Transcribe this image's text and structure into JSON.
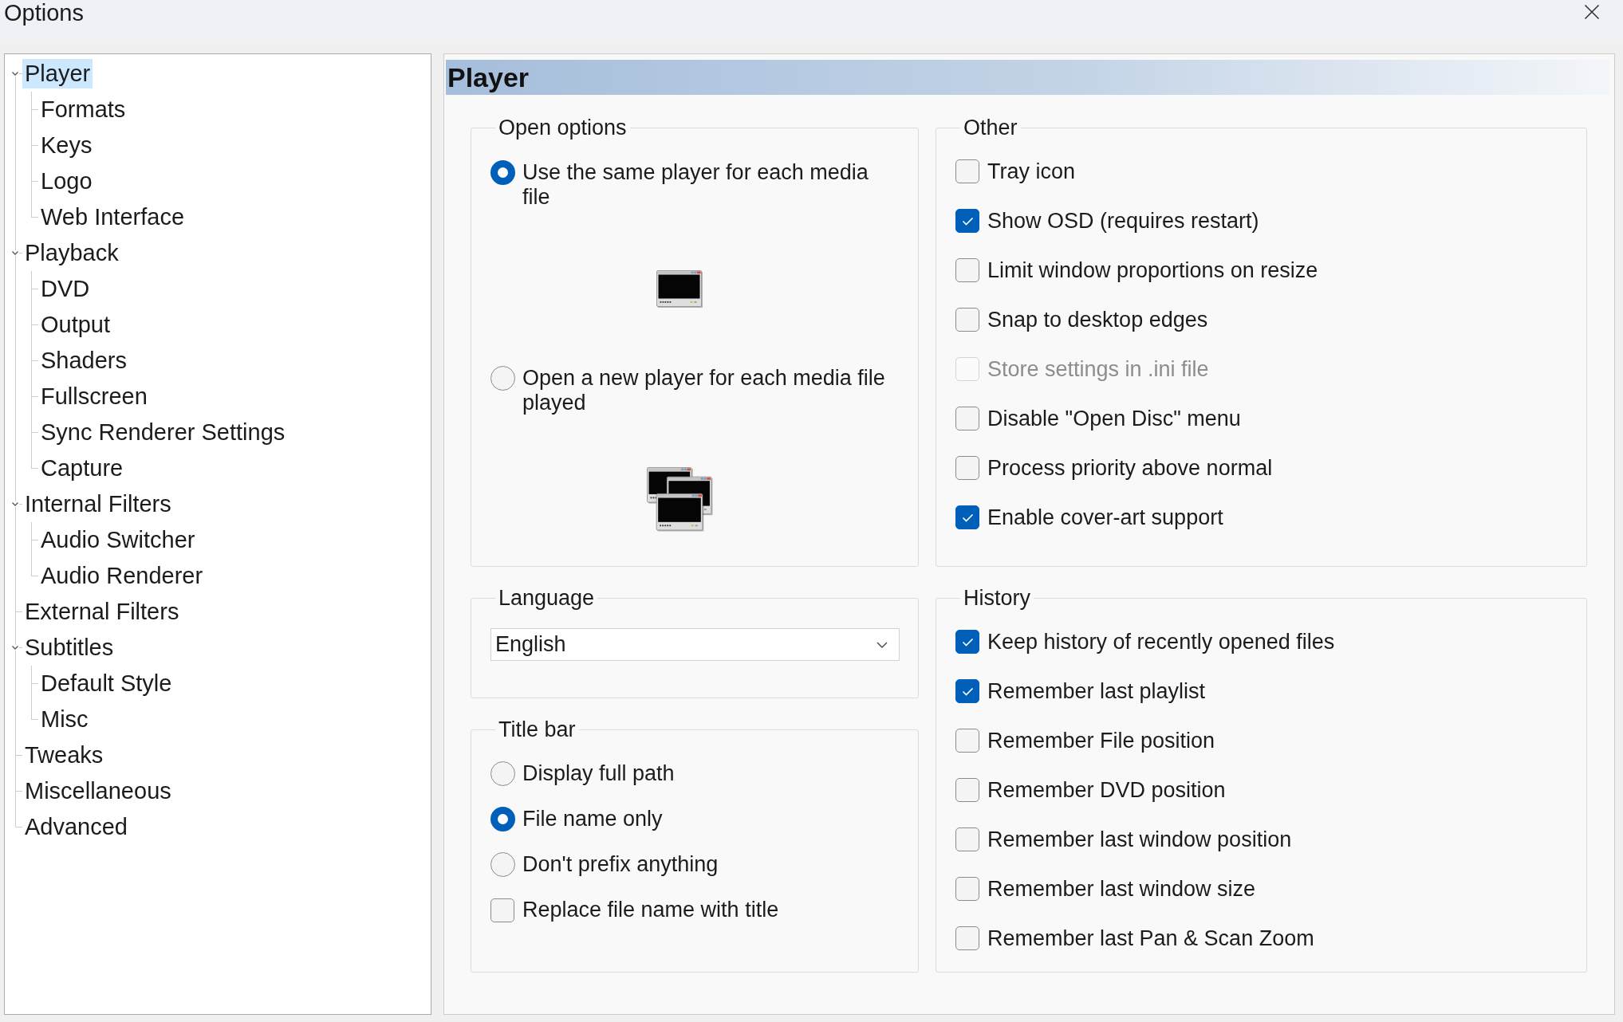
{
  "window": {
    "title": "Options"
  },
  "tree": [
    {
      "label": "Player",
      "selected": true,
      "expanded": true,
      "children": [
        {
          "label": "Formats",
          "selected": false
        },
        {
          "label": "Keys",
          "selected": false
        },
        {
          "label": "Logo",
          "selected": false
        },
        {
          "label": "Web Interface",
          "selected": false
        }
      ]
    },
    {
      "label": "Playback",
      "selected": false,
      "expanded": true,
      "children": [
        {
          "label": "DVD",
          "selected": false
        },
        {
          "label": "Output",
          "selected": false
        },
        {
          "label": "Shaders",
          "selected": false
        },
        {
          "label": "Fullscreen",
          "selected": false
        },
        {
          "label": "Sync Renderer Settings",
          "selected": false
        },
        {
          "label": "Capture",
          "selected": false
        }
      ]
    },
    {
      "label": "Internal Filters",
      "selected": false,
      "expanded": true,
      "children": [
        {
          "label": "Audio Switcher",
          "selected": false
        },
        {
          "label": "Audio Renderer",
          "selected": false
        }
      ]
    },
    {
      "label": "External Filters",
      "selected": false
    },
    {
      "label": "Subtitles",
      "selected": false,
      "expanded": true,
      "children": [
        {
          "label": "Default Style",
          "selected": false
        },
        {
          "label": "Misc",
          "selected": false
        }
      ]
    },
    {
      "label": "Tweaks",
      "selected": false
    },
    {
      "label": "Miscellaneous",
      "selected": false
    },
    {
      "label": "Advanced",
      "selected": false
    }
  ],
  "page": {
    "title": "Player"
  },
  "open_options": {
    "legend": "Open options",
    "options": [
      {
        "kind": "single-window",
        "label": "Use the same player for each media file",
        "selected": true
      },
      {
        "kind": "multiple-windows",
        "label": "Open a new player for each media file played",
        "selected": false
      }
    ]
  },
  "other": {
    "legend": "Other",
    "items": [
      {
        "label": "Tray icon",
        "checked": false,
        "disabled": false
      },
      {
        "label": "Show OSD (requires restart)",
        "checked": true,
        "disabled": false
      },
      {
        "label": "Limit window proportions on resize",
        "checked": false,
        "disabled": false
      },
      {
        "label": "Snap to desktop edges",
        "checked": false,
        "disabled": false
      },
      {
        "label": "Store settings in .ini file",
        "checked": false,
        "disabled": true
      },
      {
        "label": "Disable \"Open Disc\" menu",
        "checked": false,
        "disabled": false
      },
      {
        "label": "Process priority above normal",
        "checked": false,
        "disabled": false
      },
      {
        "label": "Enable cover-art support",
        "checked": true,
        "disabled": false
      }
    ]
  },
  "language": {
    "legend": "Language",
    "value": "English"
  },
  "title_bar": {
    "legend": "Title bar",
    "items": [
      {
        "kind": "radio",
        "label": "Display full path",
        "selected": false
      },
      {
        "kind": "radio",
        "label": "File name only",
        "selected": true
      },
      {
        "kind": "radio",
        "label": "Don't prefix anything",
        "selected": false
      },
      {
        "kind": "checkbox",
        "label": "Replace file name with title",
        "checked": false
      }
    ]
  },
  "history": {
    "legend": "History",
    "items": [
      {
        "label": "Keep history of recently opened files",
        "checked": true
      },
      {
        "label": "Remember last playlist",
        "checked": true
      },
      {
        "label": "Remember File position",
        "checked": false
      },
      {
        "label": "Remember DVD position",
        "checked": false
      },
      {
        "label": "Remember last window position",
        "checked": false
      },
      {
        "label": "Remember last window size",
        "checked": false
      },
      {
        "label": "Remember last Pan & Scan Zoom",
        "checked": false
      }
    ]
  }
}
